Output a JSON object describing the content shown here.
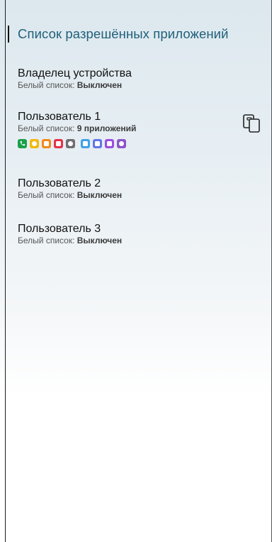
{
  "header": {
    "title": "Список разрешённых приложений"
  },
  "status_prefix": "Белый список: ",
  "users": [
    {
      "name": "Владелец устройства",
      "status": "Выключен"
    },
    {
      "name": "Пользователь 1",
      "status": "9 приложений"
    },
    {
      "name": "Пользователь 2",
      "status": "Выключен"
    },
    {
      "name": "Пользователь 3",
      "status": "Выключен"
    }
  ],
  "apps": [
    {
      "icon": "phone-app-icon",
      "color": "#1aa04a"
    },
    {
      "icon": "messages-app-icon",
      "color": "#f2b90f"
    },
    {
      "icon": "contacts-app-icon",
      "color": "#f28a1c"
    },
    {
      "icon": "video-app-icon",
      "color": "#e5314a"
    },
    {
      "icon": "settings-app-icon",
      "color": "#6e6e73"
    },
    {
      "icon": "help-app-icon",
      "color": "#3fa2e8"
    },
    {
      "icon": "calculator-app-icon",
      "color": "#6277e6"
    },
    {
      "icon": "notes-app-icon",
      "color": "#9b4de3"
    },
    {
      "icon": "clock-app-icon",
      "color": "#8a55c9"
    }
  ],
  "copy_icon": "copy-icon"
}
